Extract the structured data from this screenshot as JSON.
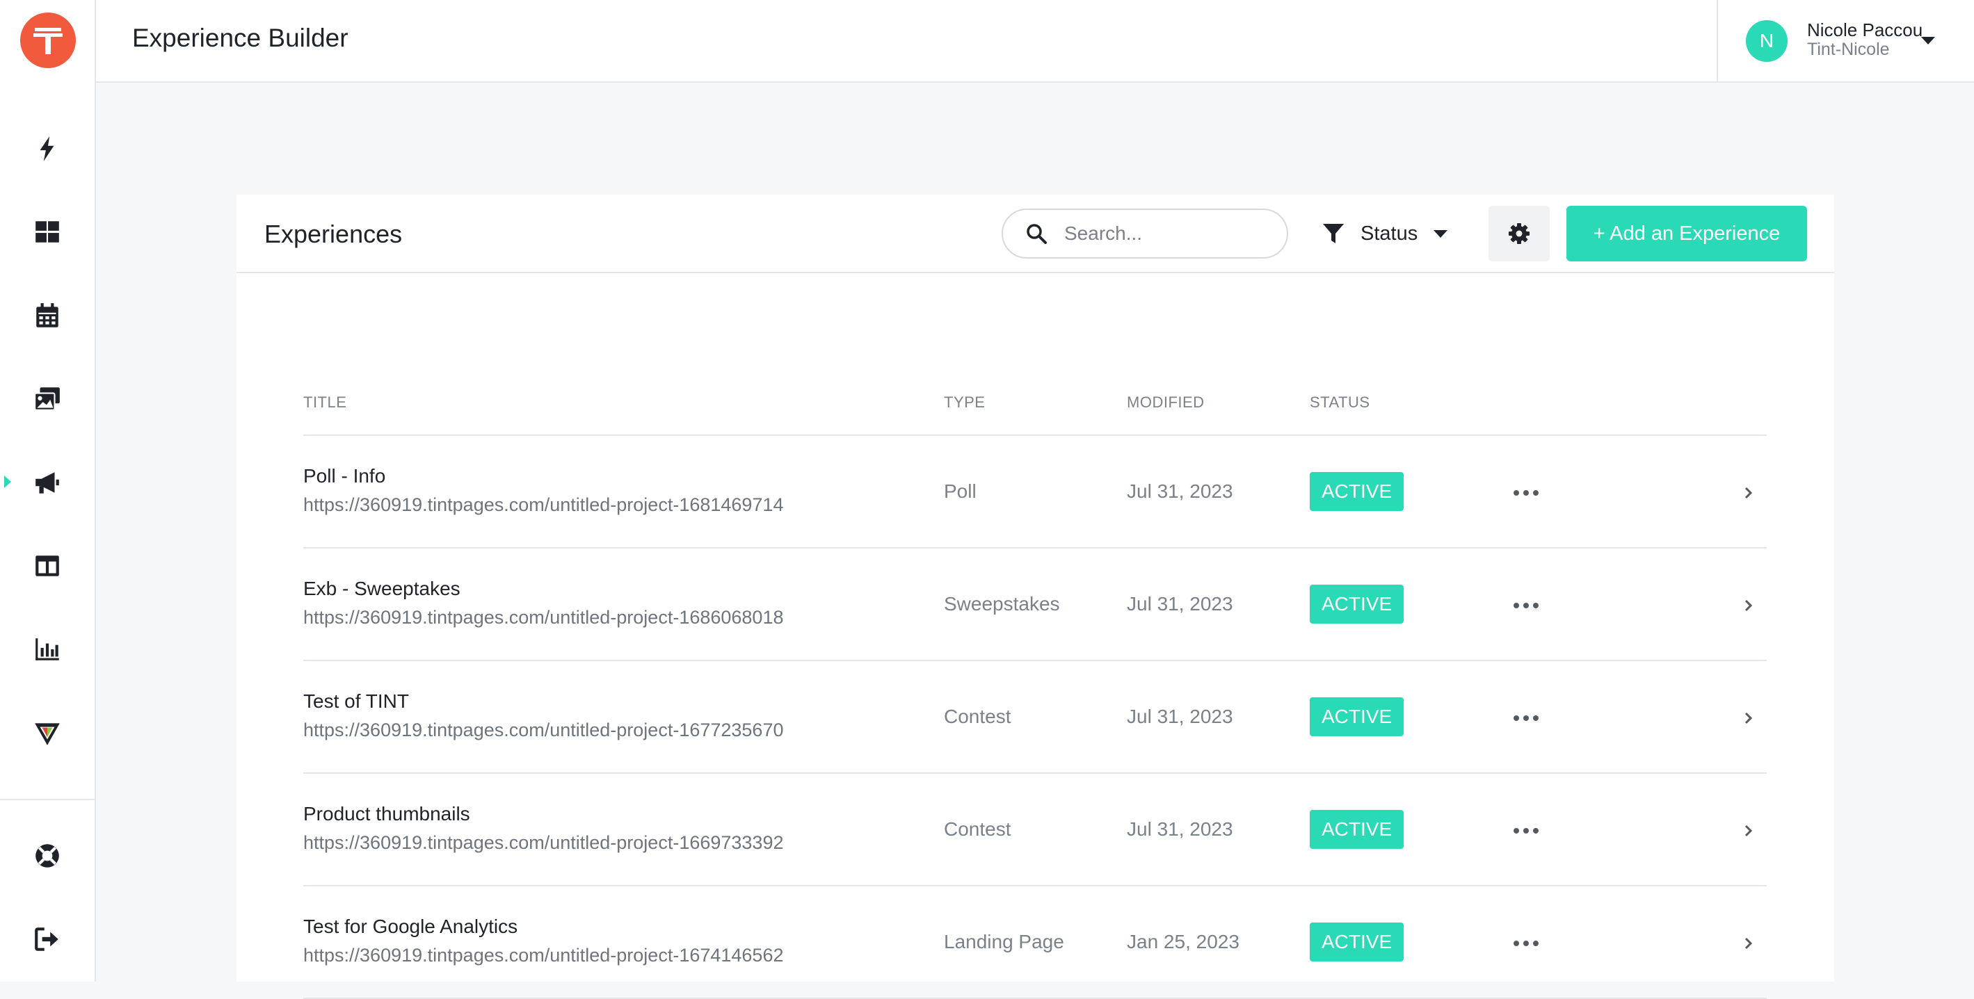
{
  "colors": {
    "brand": "#f25a3e",
    "accent": "#2ad9b5",
    "text": "#1f2329",
    "muted": "#7b8089",
    "border": "#e4e6ea",
    "background": "#f6f7f9"
  },
  "sidebar": {
    "logo_icon": "tint-logo",
    "nav": [
      {
        "icon": "lightning-icon",
        "active": false
      },
      {
        "icon": "dashboard-icon",
        "active": false
      },
      {
        "icon": "calendar-icon",
        "active": false
      },
      {
        "icon": "gallery-icon",
        "active": false
      },
      {
        "icon": "megaphone-icon",
        "active": true
      },
      {
        "icon": "layout-icon",
        "active": false
      },
      {
        "icon": "bar-chart-icon",
        "active": false
      },
      {
        "icon": "vee-logo-icon",
        "active": false
      }
    ],
    "bottom": [
      {
        "icon": "help-lifebuoy-icon"
      },
      {
        "icon": "logout-icon"
      }
    ]
  },
  "header": {
    "title": "Experience Builder",
    "user": {
      "initial": "N",
      "name": "Nicole Paccou",
      "org": "Tint-Nicole"
    }
  },
  "card": {
    "title": "Experiences",
    "search": {
      "placeholder": "Search...",
      "value": ""
    },
    "filter": {
      "label": "Status"
    },
    "add_button": "+ Add an Experience"
  },
  "table": {
    "columns": {
      "title": "TITLE",
      "type": "TYPE",
      "modified": "MODIFIED",
      "status": "STATUS"
    },
    "rows": [
      {
        "title": "Poll - Info",
        "url": "https://360919.tintpages.com/untitled-project-1681469714",
        "type": "Poll",
        "modified": "Jul 31, 2023",
        "status": "ACTIVE"
      },
      {
        "title": "Exb - Sweeptakes",
        "url": "https://360919.tintpages.com/untitled-project-1686068018",
        "type": "Sweepstakes",
        "modified": "Jul 31, 2023",
        "status": "ACTIVE"
      },
      {
        "title": "Test of TINT",
        "url": "https://360919.tintpages.com/untitled-project-1677235670",
        "type": "Contest",
        "modified": "Jul 31, 2023",
        "status": "ACTIVE"
      },
      {
        "title": "Product thumbnails",
        "url": "https://360919.tintpages.com/untitled-project-1669733392",
        "type": "Contest",
        "modified": "Jul 31, 2023",
        "status": "ACTIVE"
      },
      {
        "title": "Test for Google Analytics",
        "url": "https://360919.tintpages.com/untitled-project-1674146562",
        "type": "Landing Page",
        "modified": "Jan 25, 2023",
        "status": "ACTIVE"
      }
    ]
  }
}
